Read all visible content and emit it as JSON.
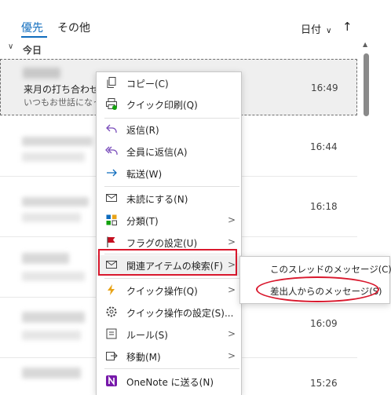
{
  "tabs": {
    "focused": "優先",
    "other": "その他"
  },
  "sort": {
    "label": "日付",
    "chevron": "∨",
    "direction_icon": "↑"
  },
  "group": {
    "label": "今日",
    "chevron": "∨"
  },
  "selected_mail": {
    "subject": "来月の打ち合わせ",
    "preview": "いつもお世話になって",
    "time": "16:49"
  },
  "mail_times": [
    "16:44",
    "16:18",
    "16:09",
    "15:26"
  ],
  "context_menu": {
    "copy": "コピー(C)",
    "quick_print": "クイック印刷(Q)",
    "reply": "返信(R)",
    "reply_all": "全員に返信(A)",
    "forward": "転送(W)",
    "mark_unread": "未読にする(N)",
    "categorize": "分類(T)",
    "flag": "フラグの設定(U)",
    "find_related": "関連アイテムの検索(F)",
    "quick_steps": "クイック操作(Q)",
    "quick_steps_settings": "クイック操作の設定(S)...",
    "rules": "ルール(S)",
    "move": "移動(M)",
    "onenote": "OneNote に送る(N)"
  },
  "submenu": {
    "thread_messages": "このスレッドのメッセージ(C)",
    "sender_messages": "差出人からのメッセージ(S)"
  },
  "icons": {
    "copy": "copy-icon",
    "print": "printer-icon",
    "reply": "reply-icon",
    "reply_all": "reply-all-icon",
    "forward": "forward-icon",
    "unread": "envelope-icon",
    "categorize": "category-icon",
    "flag": "flag-icon",
    "related": "envelope-search-icon",
    "quick": "lightning-icon",
    "settings": "gear-icon",
    "rules": "rules-icon",
    "move": "move-icon",
    "onenote": "onenote-icon"
  },
  "colors": {
    "accent": "#0f6cbd",
    "annotation": "#d9182d",
    "flag": "#c50f1f",
    "onenote": "#7719aa"
  }
}
